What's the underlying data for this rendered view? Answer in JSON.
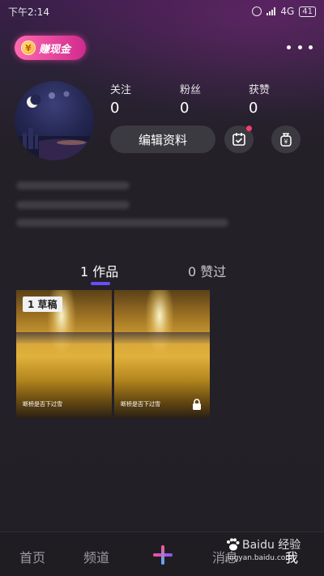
{
  "status_bar": {
    "time": "下午2:14",
    "network": "4G",
    "battery": "41"
  },
  "header": {
    "cash_badge_label": "赚现金",
    "cash_badge_icon": "coin-icon",
    "more_icon": "more-dots-icon"
  },
  "profile": {
    "stats": [
      {
        "label": "关注",
        "value": "0"
      },
      {
        "label": "粉丝",
        "value": "0"
      },
      {
        "label": "获赞",
        "value": "0"
      }
    ],
    "edit_label": "编辑资料"
  },
  "tabs": [
    {
      "count": "1",
      "label": "作品"
    },
    {
      "count": "0",
      "label": "赞过"
    }
  ],
  "videos": [
    {
      "tag": "1 草稿",
      "caption": "断桥是否下过雪"
    },
    {
      "tag": "",
      "caption": "断桥是否下过雪",
      "locked": true
    }
  ],
  "bottom_nav": [
    {
      "label": "首页"
    },
    {
      "label": "频道"
    },
    {
      "label": "消息"
    },
    {
      "label": "我"
    }
  ],
  "watermark": {
    "brand": "Baidu 经验",
    "url": "jingyan.baidu.com"
  },
  "colors": {
    "accent_purple": "#6c4df5",
    "badge_pink": "#e0429a",
    "notify_red": "#ff3b6b"
  }
}
